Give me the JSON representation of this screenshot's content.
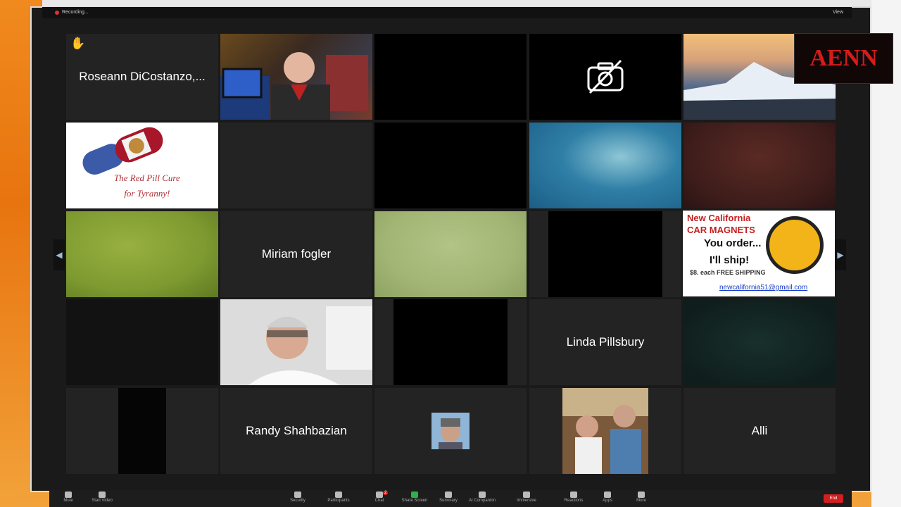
{
  "window": {
    "title_left": "Recording...",
    "title_right": "View"
  },
  "participants": [
    {
      "id": "roseann",
      "name": "Roseann DiCostanzo,...",
      "hand_raised": true
    },
    {
      "id": "miriam",
      "name": "Miriam fogler"
    },
    {
      "id": "linda",
      "name": "Linda Pillsbury"
    },
    {
      "id": "randy",
      "name": "Randy Shahbazian"
    },
    {
      "id": "alli",
      "name": "Alli"
    }
  ],
  "tiles": {
    "red_pill": {
      "line1": "The Red Pill Cure",
      "line2": "for Tyranny!"
    },
    "magnets": {
      "line1": "New California",
      "line2": "CAR MAGNETS",
      "line3": "You order...",
      "line4": "I'll ship!",
      "line5": "$8. each  FREE SHIPPING",
      "line6": "newcalifornia51@gmail.com"
    }
  },
  "watermark": {
    "logo": "AENN"
  },
  "toolbar": {
    "items": [
      "Mute",
      "Start Video",
      "Security",
      "Participants",
      "Chat",
      "Share Screen",
      "Summary",
      "AI Companion",
      "Immersive",
      "Reactions",
      "Apps",
      "More"
    ],
    "chat_badge": "2",
    "end_label": "End"
  },
  "icons": {
    "hand": "raised-hand-icon",
    "camera_off": "camera-off-icon",
    "prev": "chevron-left-icon",
    "next": "chevron-right-icon"
  },
  "colors": {
    "end_button": "#d21f1f",
    "logo_red": "#d51c1c",
    "badge_green": "#2bb24c"
  }
}
